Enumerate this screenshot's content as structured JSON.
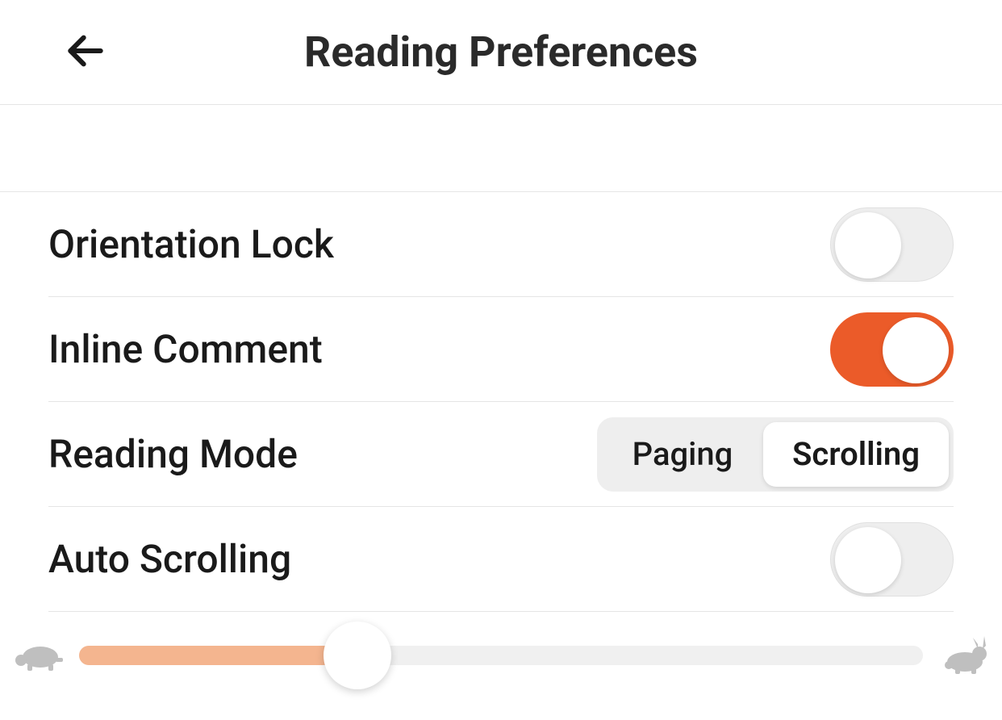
{
  "header": {
    "title": "Reading Preferences"
  },
  "settings": {
    "orientation_lock": {
      "label": "Orientation Lock",
      "value": false
    },
    "inline_comment": {
      "label": "Inline Comment",
      "value": true
    },
    "reading_mode": {
      "label": "Reading Mode",
      "options": [
        "Paging",
        "Scrolling"
      ],
      "selected": "Scrolling"
    },
    "auto_scrolling": {
      "label": "Auto Scrolling",
      "value": false
    }
  },
  "speed_slider": {
    "min_icon": "turtle-icon",
    "max_icon": "rabbit-icon",
    "value_percent": 33
  },
  "colors": {
    "accent": "#eb5b29",
    "accent_light": "#f4b58f"
  }
}
